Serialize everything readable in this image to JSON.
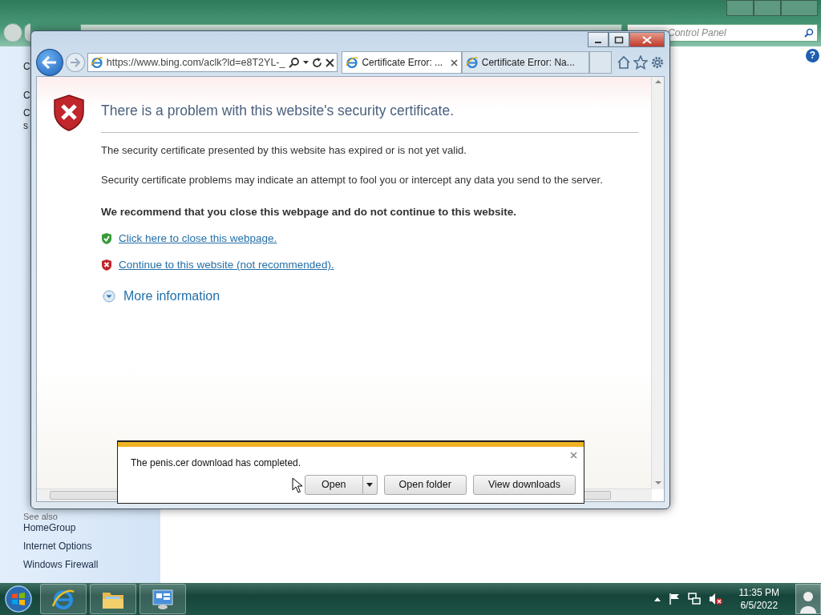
{
  "control_panel": {
    "search_placeholder": "Control Panel",
    "help": "?",
    "fragments": [
      "C",
      "C",
      "C",
      "s"
    ],
    "see_also": "See also",
    "links": [
      "HomeGroup",
      "Internet Options",
      "Windows Firewall"
    ]
  },
  "browser": {
    "address": "https://www.bing.com/aclk?ld=e8T2YL-_",
    "tabs": [
      {
        "label": "Certificate Error: ...",
        "selected": true
      },
      {
        "label": "Certificate Error: Na...",
        "selected": false
      }
    ],
    "page": {
      "heading": "There is a problem with this website's security certificate.",
      "paragraphs": [
        "The security certificate presented by this website has expired or is not yet valid.",
        "Security certificate problems may indicate an attempt to fool you or intercept any data you send to the server."
      ],
      "recommendation": "We recommend that you close this webpage and do not continue to this website.",
      "actions": [
        {
          "label": "Click here to close this webpage.",
          "kind": "safe"
        },
        {
          "label": "Continue to this website (not recommended).",
          "kind": "unsafe"
        }
      ],
      "more_info": "More information",
      "expanded": false
    }
  },
  "download_bar": {
    "message": "The penis.cer download has completed.",
    "buttons": [
      {
        "label": "Open",
        "kind": "split"
      },
      {
        "label": "Open folder",
        "kind": "plain"
      },
      {
        "label": "View downloads",
        "kind": "plain"
      }
    ]
  },
  "taskbar": {
    "time": "11:35 PM",
    "date": "6/5/2022",
    "muted": true
  }
}
